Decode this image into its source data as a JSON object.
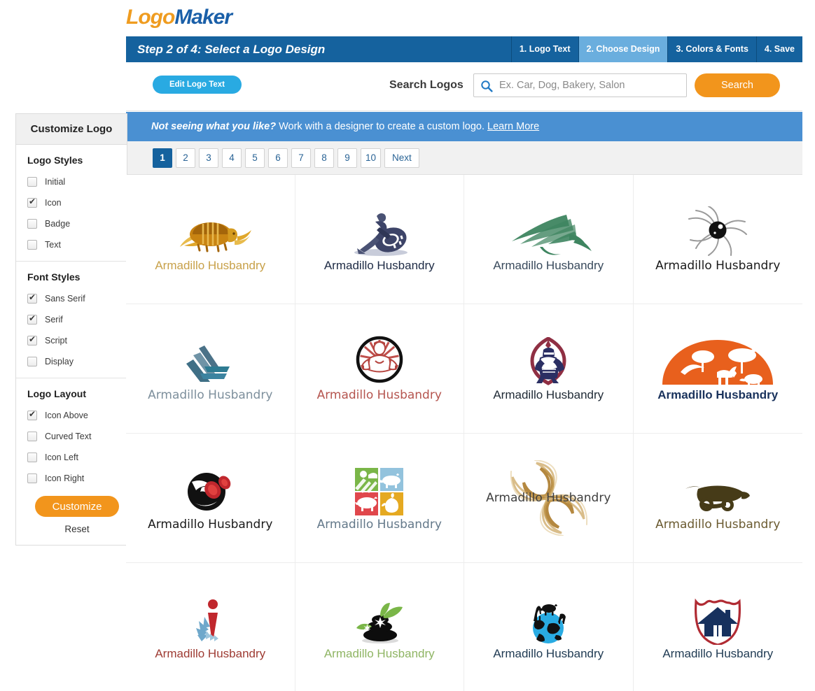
{
  "brand": {
    "part1": "Logo",
    "part2": "Maker"
  },
  "header": {
    "step_title": "Step 2 of 4: Select a Logo Design",
    "tabs": [
      {
        "label": "1. Logo Text",
        "active": false
      },
      {
        "label": "2. Choose Design",
        "active": true
      },
      {
        "label": "3. Colors & Fonts",
        "active": false
      },
      {
        "label": "4. Save",
        "active": false
      }
    ],
    "active_tab_color": "#6aaede",
    "bar_color": "#15629e"
  },
  "toolbar": {
    "edit_logo_text_label": "Edit Logo Text",
    "search_logos_label": "Search Logos",
    "search_placeholder": "Ex. Car, Dog, Bakery, Salon",
    "search_value": "",
    "search_button_label": "Search",
    "edit_button_color": "#29aae2",
    "search_button_color": "#f2951c"
  },
  "notice": {
    "strong_text": "Not seeing what you like?",
    "text": " Work with a designer to create a custom logo. ",
    "link_label": "Learn More",
    "background": "#4a90d2"
  },
  "pagination": {
    "pages": [
      "1",
      "2",
      "3",
      "4",
      "5",
      "6",
      "7",
      "8",
      "9",
      "10"
    ],
    "current": "1",
    "next_label": "Next",
    "active_color": "#15629e"
  },
  "sidebar": {
    "title": "Customize Logo",
    "sections": [
      {
        "title": "Logo Styles",
        "options": [
          {
            "label": "Initial",
            "checked": false
          },
          {
            "label": "Icon",
            "checked": true
          },
          {
            "label": "Badge",
            "checked": false
          },
          {
            "label": "Text",
            "checked": false
          }
        ]
      },
      {
        "title": "Font Styles",
        "options": [
          {
            "label": "Sans Serif",
            "checked": true
          },
          {
            "label": "Serif",
            "checked": true
          },
          {
            "label": "Script",
            "checked": true
          },
          {
            "label": "Display",
            "checked": false
          }
        ]
      },
      {
        "title": "Logo Layout",
        "options": [
          {
            "label": "Icon Above",
            "checked": true
          },
          {
            "label": "Curved Text",
            "checked": false
          },
          {
            "label": "Icon Left",
            "checked": false
          },
          {
            "label": "Icon Right",
            "checked": false
          }
        ]
      }
    ],
    "customize_label": "Customize",
    "reset_label": "Reset",
    "customize_button_color": "#f2951c"
  },
  "logo_grid": {
    "company_name": "Armadillo Husbandry",
    "items": [
      {
        "icon": "armadillo-icon",
        "text_color": "#c8a14a",
        "font": "f-sans",
        "size": "17px",
        "weight": "",
        "layout": "above"
      },
      {
        "icon": "tire-push-icon",
        "text_color": "#1d2a44",
        "font": "f-sans",
        "size": "17px",
        "weight": "",
        "layout": "above"
      },
      {
        "icon": "green-bird-icon",
        "text_color": "#394a5c",
        "font": "f-sans",
        "size": "17px",
        "weight": "",
        "layout": "above"
      },
      {
        "icon": "eye-swirl-icon",
        "text_color": "#1a1a1a",
        "font": "f-mono",
        "size": "17px",
        "weight": "",
        "layout": "above"
      },
      {
        "icon": "blue-ribbon-icon",
        "text_color": "#7d8f9c",
        "font": "f-mono",
        "size": "17px",
        "weight": "",
        "layout": "above"
      },
      {
        "icon": "strongman-icon",
        "text_color": "#b5554f",
        "font": "f-mono",
        "size": "17px",
        "weight": "",
        "layout": "above"
      },
      {
        "icon": "knight-icon",
        "text_color": "#1f2a35",
        "font": "f-sans",
        "size": "17px",
        "weight": "",
        "layout": "above"
      },
      {
        "icon": "safari-globe-icon",
        "text_color": "#19325c",
        "font": "f-sans",
        "size": "17px",
        "weight": "w-bold",
        "layout": "above"
      },
      {
        "icon": "barbell-circle-icon",
        "text_color": "#1a1a1a",
        "font": "f-mono",
        "size": "17px",
        "weight": "",
        "layout": "above"
      },
      {
        "icon": "farm-squares-icon",
        "text_color": "#64798a",
        "font": "f-mono",
        "size": "17px",
        "weight": "",
        "layout": "above"
      },
      {
        "icon": "gold-swirl-icon",
        "text_color": "#3f3f3f",
        "font": "f-mono",
        "size": "17px",
        "weight": "",
        "layout": "overlay"
      },
      {
        "icon": "cart-icon",
        "text_color": "#6b5b31",
        "font": "f-mono",
        "size": "17px",
        "weight": "",
        "layout": "above"
      },
      {
        "icon": "fan-figure-icon",
        "text_color": "#9e3b33",
        "font": "f-sans",
        "size": "17px",
        "weight": "",
        "layout": "above"
      },
      {
        "icon": "stones-leaf-icon",
        "text_color": "#8fb564",
        "font": "f-sans",
        "size": "17px",
        "weight": "",
        "layout": "above"
      },
      {
        "icon": "animal-globe-icon",
        "text_color": "#1f3a52",
        "font": "f-sans",
        "size": "17px",
        "weight": "",
        "layout": "above"
      },
      {
        "icon": "house-shield-icon",
        "text_color": "#1f3a52",
        "font": "f-sans",
        "size": "17px",
        "weight": "",
        "layout": "above"
      }
    ]
  }
}
